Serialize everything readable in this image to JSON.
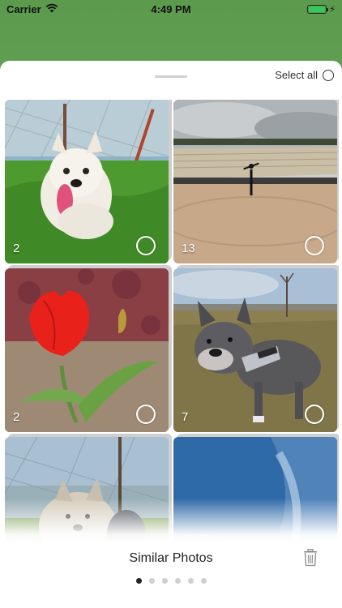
{
  "status_bar": {
    "carrier": "Carrier",
    "time": "4:49 PM",
    "battery_level": 1.0,
    "icons": [
      "wifi-icon",
      "battery-icon",
      "charging-bolt-icon"
    ]
  },
  "header": {
    "select_all_label": "Select all"
  },
  "photos": [
    {
      "count": "2",
      "subject": "white terrier on grass"
    },
    {
      "count": "13",
      "subject": "person in stadium"
    },
    {
      "count": "2",
      "subject": "red tulip"
    },
    {
      "count": "7",
      "subject": "french bulldog"
    },
    {
      "count": "",
      "subject": "terrier by fence"
    },
    {
      "count": "",
      "subject": "blue sky"
    }
  ],
  "footer": {
    "title": "Similar Photos",
    "page_count": 6,
    "active_page": 1
  },
  "colors": {
    "accent": "#35c759",
    "text": "#222222",
    "dot_active": "#222222",
    "dot_inactive": "#cfcfcf"
  }
}
